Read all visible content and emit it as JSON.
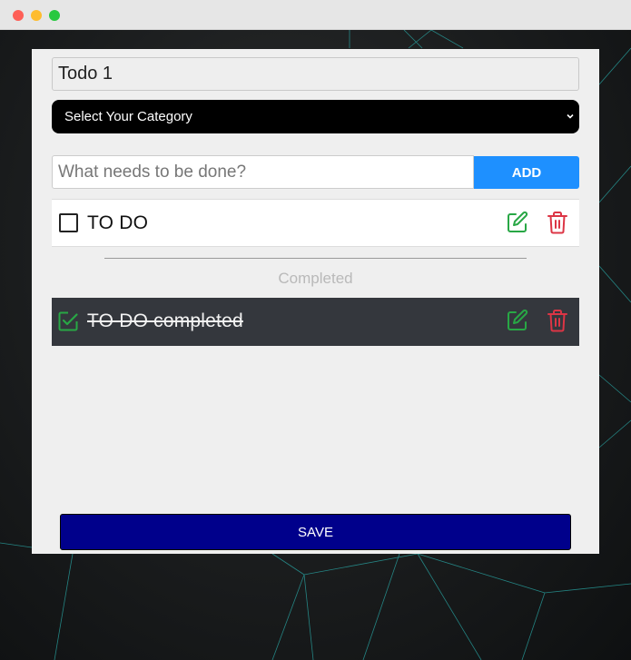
{
  "todo_list": {
    "title_value": "Todo 1",
    "category": {
      "selected": "Select Your Category"
    },
    "new_todo": {
      "placeholder": "What needs to be done?",
      "add_label": "ADD"
    },
    "active_items": [
      {
        "text": "TO DO",
        "completed": false
      }
    ],
    "completed_heading": "Completed",
    "completed_items": [
      {
        "text": "TO DO completed",
        "completed": true
      }
    ],
    "save_label": "SAVE"
  },
  "icons": {
    "checkbox": "checkbox-icon",
    "checked": "checkbox-checked-icon",
    "edit": "edit-icon",
    "delete": "trash-icon",
    "dropdown": "chevron-down-icon"
  },
  "colors": {
    "add_button": "#1e90ff",
    "save_button": "#00008b",
    "edit_icon": "#28a745",
    "delete_icon": "#dc3545",
    "completed_row": "#34373d",
    "category_select": "#000000"
  }
}
